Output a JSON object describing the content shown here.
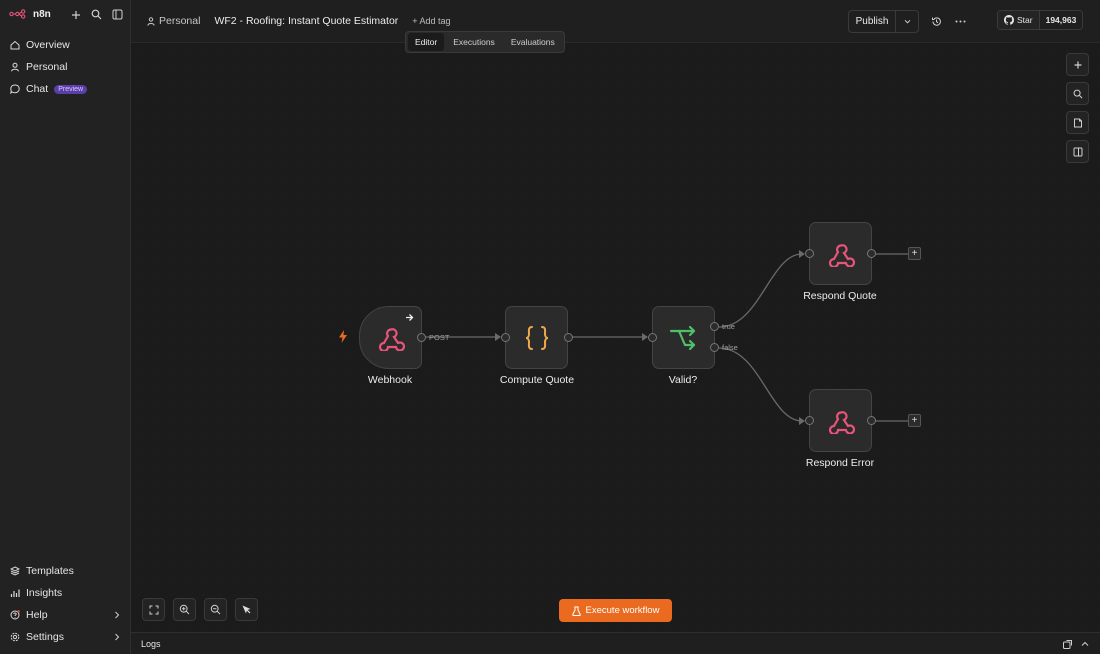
{
  "app": {
    "brand": "n8n"
  },
  "sidebar": {
    "items": [
      {
        "label": "Overview",
        "icon": "home-icon"
      },
      {
        "label": "Personal",
        "icon": "user-icon"
      },
      {
        "label": "Chat",
        "icon": "chat-icon",
        "badge": "Preview"
      }
    ],
    "bottom_items": [
      {
        "label": "Templates",
        "icon": "templates-icon"
      },
      {
        "label": "Insights",
        "icon": "insights-icon"
      },
      {
        "label": "Help",
        "icon": "help-icon"
      },
      {
        "label": "Settings",
        "icon": "settings-icon"
      }
    ]
  },
  "header": {
    "project": "Personal",
    "workflow_name": "WF2 - Roofing: Instant Quote Estimator",
    "add_tag": "+ Add tag",
    "tabs": [
      "Editor",
      "Executions",
      "Evaluations"
    ],
    "active_tab": "Editor",
    "publish_label": "Publish",
    "github_star_label": "Star",
    "github_star_count": "194,963"
  },
  "canvas": {
    "nodes": [
      {
        "id": "webhook",
        "label": "Webhook",
        "icon": "webhook-icon",
        "output_label": "POST"
      },
      {
        "id": "compute",
        "label": "Compute Quote",
        "icon": "code-braces-icon"
      },
      {
        "id": "valid",
        "label": "Valid?",
        "icon": "if-branch-icon",
        "outputs": [
          "true",
          "false"
        ]
      },
      {
        "id": "respond_quote",
        "label": "Respond Quote",
        "icon": "webhook-icon"
      },
      {
        "id": "respond_error",
        "label": "Respond Error",
        "icon": "webhook-icon"
      }
    ],
    "execute_label": "Execute workflow"
  },
  "logs": {
    "label": "Logs"
  },
  "colors": {
    "accent": "#ea6b1f",
    "webhook": "#e8547a",
    "code": "#f0a94a",
    "if": "#4fbf6a"
  }
}
